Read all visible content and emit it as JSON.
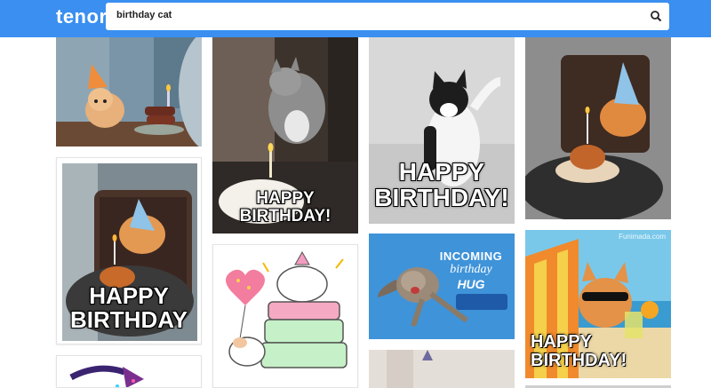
{
  "app": {
    "logo": "tenor"
  },
  "search": {
    "query": "birthday cat"
  },
  "tiles": [
    {
      "caption": ""
    },
    {
      "caption_l1": "HAPPY",
      "caption_l2": "BIRTHDAY!"
    },
    {
      "caption_l1": "HAPPY",
      "caption_l2": "BIRTHDAY!"
    },
    {
      "caption": ""
    },
    {
      "caption_l1": "HAPPY",
      "caption_l2": "BIRTHDAY"
    },
    {
      "caption": ""
    },
    {
      "line1": "INCOMING",
      "line2": "birthday",
      "line3": "HUG"
    },
    {
      "watermark": "Funimada.com",
      "caption_l1": "HAPPY",
      "caption_l2": "BIRTHDAY!"
    }
  ]
}
